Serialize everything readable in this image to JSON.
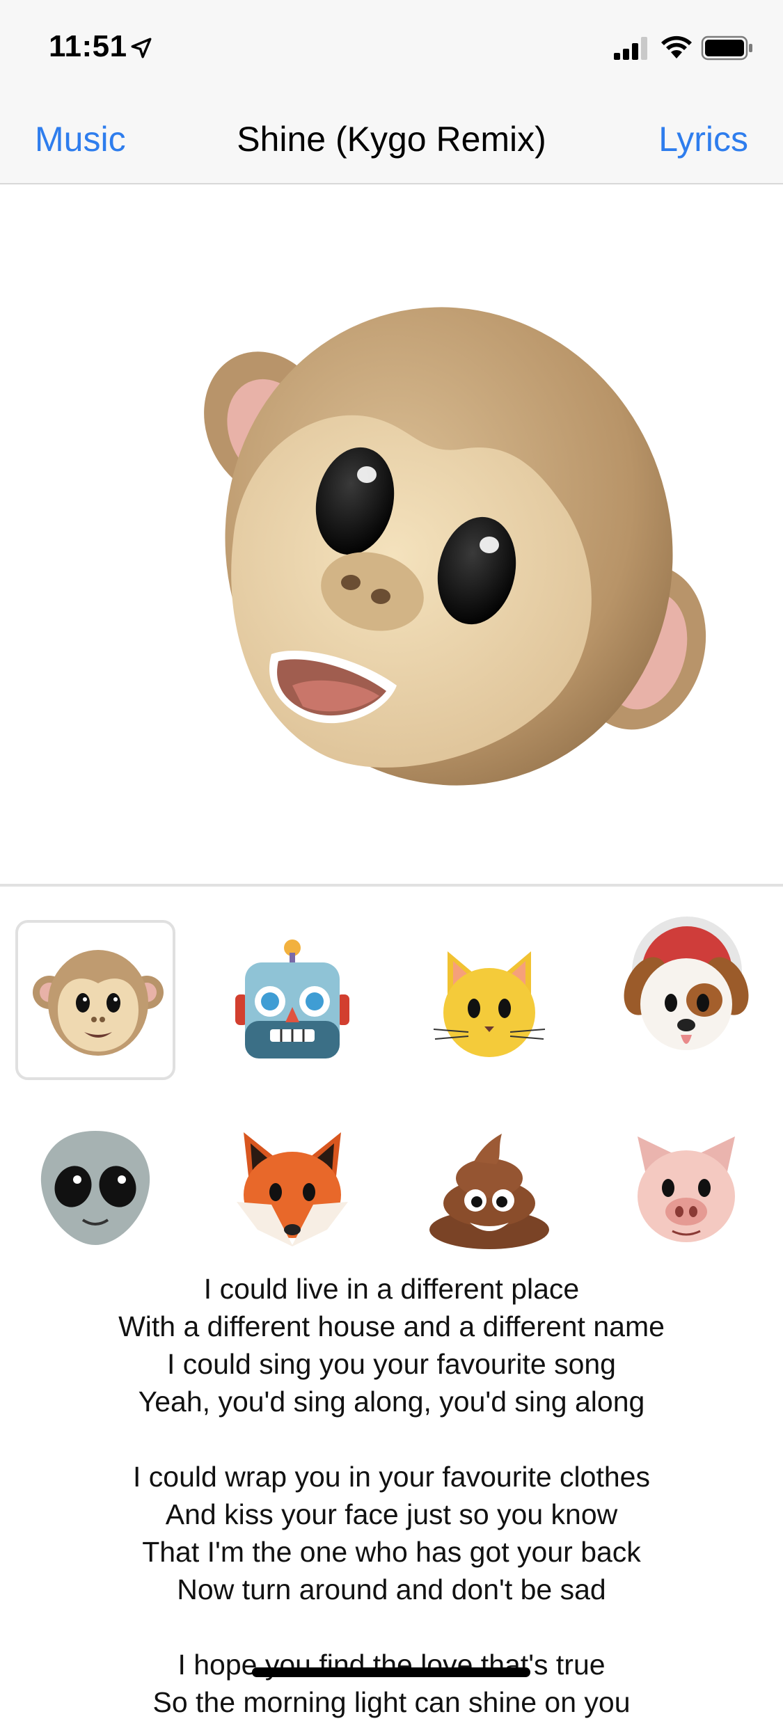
{
  "status": {
    "time": "11:51"
  },
  "nav": {
    "left_label": "Music",
    "title": "Shine (Kygo Remix)",
    "right_label": "Lyrics"
  },
  "preview": {
    "selected_animoji": "monkey"
  },
  "animoji": [
    {
      "name": "monkey",
      "selected": true
    },
    {
      "name": "robot",
      "selected": false
    },
    {
      "name": "cat",
      "selected": false
    },
    {
      "name": "dog",
      "selected": false
    },
    {
      "name": "alien",
      "selected": false
    },
    {
      "name": "fox",
      "selected": false
    },
    {
      "name": "poop",
      "selected": false
    },
    {
      "name": "pig",
      "selected": false
    }
  ],
  "lyrics": {
    "stanzas": [
      [
        "I could live in a different place",
        "With a different house and a different name",
        "I could sing you your favourite song",
        "Yeah, you'd sing along, you'd sing along"
      ],
      [
        "I could wrap you in your favourite clothes",
        "And kiss your face just so you know",
        "That I'm the one who has got your back",
        "Now turn around and don't be sad"
      ],
      [
        "I hope you find the love that's true",
        "So the morning light can shine on you"
      ]
    ]
  },
  "colors": {
    "accent": "#2e7ded",
    "record": "#cf3d3a",
    "bar_background": "#f7f7f7"
  }
}
